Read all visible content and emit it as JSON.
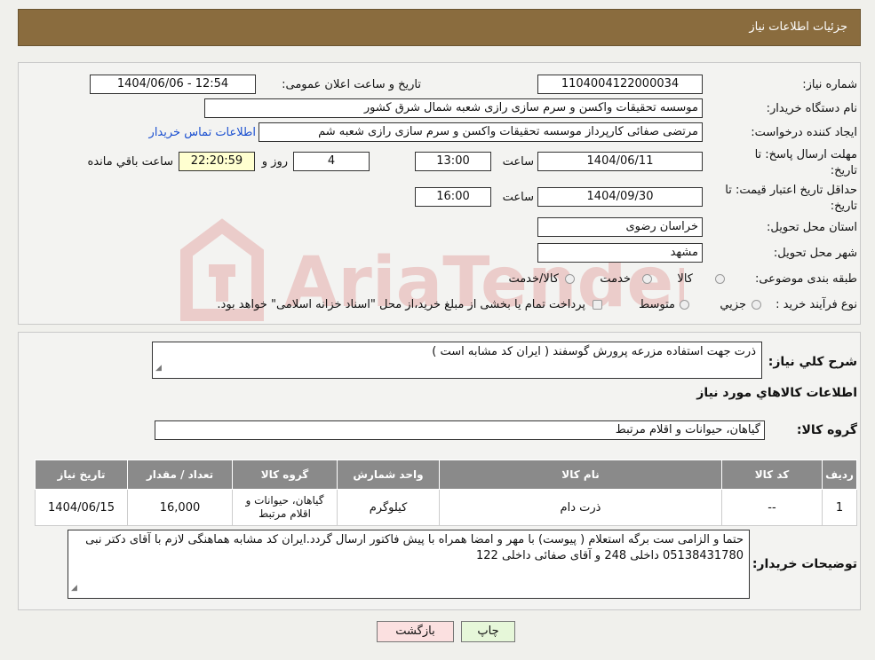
{
  "header": {
    "title": "جزئیات اطلاعات نیاز"
  },
  "labels": {
    "need_number": "شماره نیاز:",
    "announce_datetime": "تاریخ و ساعت اعلان عمومی:",
    "buyer_org": "نام دستگاه خریدار:",
    "requester": "ایجاد کننده درخواست:",
    "buyer_contact": "اطلاعات تماس خریدار",
    "deadline_line1": "مهلت ارسال پاسخ: تا",
    "deadline_line2": "تاریخ:",
    "time": "ساعت",
    "day_and": "روز و",
    "remaining": "ساعت باقي مانده",
    "validity_line1": "حداقل تاریخ اعتبار قیمت: تا",
    "validity_line2": "تاریخ:",
    "province": "استان محل تحویل:",
    "city": "شهر محل تحویل:",
    "category": "طبقه بندی موضوعی:",
    "cat_goods": "کالا",
    "cat_service": "خدمت",
    "cat_both": "کالا/خدمت",
    "process": "نوع فرآیند خرید :",
    "proc_partial": "جزیي",
    "proc_medium": "متوسط",
    "payment_note": "پرداخت تمام یا بخشی از مبلغ خرید،از محل \"اسناد خزانه اسلامی\" خواهد بود.",
    "summary": "شرح كلي نياز:",
    "goods_info": "اطلاعات كالاهاي مورد نياز",
    "goods_group": "گروه كالا:",
    "buyer_notes": "توضیحات خریدار:"
  },
  "values": {
    "need_number": "1104004122000034",
    "announce_datetime": "1404/06/06 - 12:54",
    "buyer_org": "موسسه تحقیقات واکسن و سرم سازی رازی شعبه شمال شرق کشور",
    "requester": "مرتضی صفائی کارپرداز موسسه تحقیقات واکسن و سرم سازی رازی شعبه شم",
    "deadline_date": "1404/06/11",
    "deadline_time": "13:00",
    "deadline_days": "4",
    "remaining_time": "22:20:59",
    "validity_date": "1404/09/30",
    "validity_time": "16:00",
    "province": "خراسان رضوی",
    "city": "مشهد",
    "summary": "ذرت جهت استفاده مزرعه پرورش گوسفند ( ایران کد مشابه است )",
    "goods_group": "گیاهان، حیوانات و اقلام مرتبط",
    "buyer_notes": "حتما و الزامی ست برگه استعلام ( پیوست) با مهر و امضا همراه با پیش فاکتور ارسال گردد.ایران کد مشابه هماهنگی لازم با آقای دکتر نبی 05138431780 داخلی 248 و آقای صفائی داخلی 122"
  },
  "table": {
    "headers": [
      "رديف",
      "كد كالا",
      "نام كالا",
      "واحد شمارش",
      "گروه كالا",
      "تعداد / مقدار",
      "تاريخ نياز"
    ],
    "rows": [
      [
        "1",
        "--",
        "ذرت دام",
        "کیلوگرم",
        "گیاهان، حیوانات و اقلام مرتبط",
        "16,000",
        "1404/06/15"
      ]
    ]
  },
  "buttons": {
    "print": "چاپ",
    "back": "بازگشت"
  },
  "watermark": "AriaTender.neT",
  "colors": {
    "header_bg": "#8a6c3e",
    "table_header_bg": "#8a8a8a",
    "remaining_bg": "#ffffd0",
    "print_bg": "#e6f7d9",
    "back_bg": "#fbe0e0",
    "link": "#1a4fd0"
  }
}
